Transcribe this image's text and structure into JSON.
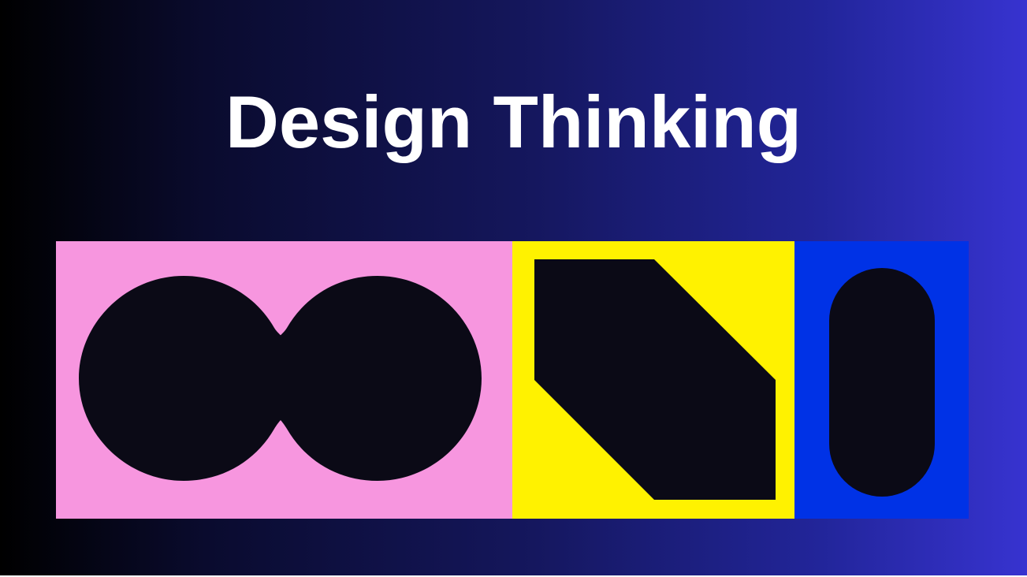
{
  "slide": {
    "title": "Design Thinking"
  },
  "colors": {
    "shape_fill": "#0b0a16",
    "title_text": "#ffffff",
    "panel_left_bg": "#f796df",
    "panel_middle_bg": "#fff200",
    "panel_right_bg": "#0032e6",
    "background_gradient": [
      "#000000",
      "#14165a",
      "#3733d0"
    ]
  },
  "panels": [
    {
      "name": "pink-panel",
      "shape": "merged-circles"
    },
    {
      "name": "yellow-panel",
      "shape": "cut-corner-hexagon"
    },
    {
      "name": "blue-panel",
      "shape": "pill"
    }
  ]
}
